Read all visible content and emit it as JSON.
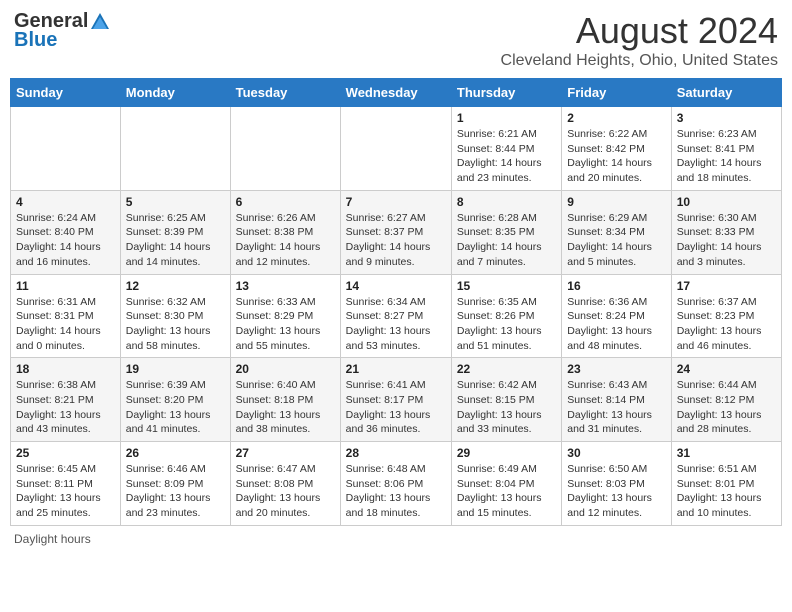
{
  "header": {
    "logo_general": "General",
    "logo_blue": "Blue",
    "month_title": "August 2024",
    "location": "Cleveland Heights, Ohio, United States"
  },
  "days_of_week": [
    "Sunday",
    "Monday",
    "Tuesday",
    "Wednesday",
    "Thursday",
    "Friday",
    "Saturday"
  ],
  "footer": {
    "daylight_hours": "Daylight hours"
  },
  "weeks": [
    {
      "days": [
        {
          "number": "",
          "info": ""
        },
        {
          "number": "",
          "info": ""
        },
        {
          "number": "",
          "info": ""
        },
        {
          "number": "",
          "info": ""
        },
        {
          "number": "1",
          "info": "Sunrise: 6:21 AM\nSunset: 8:44 PM\nDaylight: 14 hours and 23 minutes."
        },
        {
          "number": "2",
          "info": "Sunrise: 6:22 AM\nSunset: 8:42 PM\nDaylight: 14 hours and 20 minutes."
        },
        {
          "number": "3",
          "info": "Sunrise: 6:23 AM\nSunset: 8:41 PM\nDaylight: 14 hours and 18 minutes."
        }
      ]
    },
    {
      "days": [
        {
          "number": "4",
          "info": "Sunrise: 6:24 AM\nSunset: 8:40 PM\nDaylight: 14 hours and 16 minutes."
        },
        {
          "number": "5",
          "info": "Sunrise: 6:25 AM\nSunset: 8:39 PM\nDaylight: 14 hours and 14 minutes."
        },
        {
          "number": "6",
          "info": "Sunrise: 6:26 AM\nSunset: 8:38 PM\nDaylight: 14 hours and 12 minutes."
        },
        {
          "number": "7",
          "info": "Sunrise: 6:27 AM\nSunset: 8:37 PM\nDaylight: 14 hours and 9 minutes."
        },
        {
          "number": "8",
          "info": "Sunrise: 6:28 AM\nSunset: 8:35 PM\nDaylight: 14 hours and 7 minutes."
        },
        {
          "number": "9",
          "info": "Sunrise: 6:29 AM\nSunset: 8:34 PM\nDaylight: 14 hours and 5 minutes."
        },
        {
          "number": "10",
          "info": "Sunrise: 6:30 AM\nSunset: 8:33 PM\nDaylight: 14 hours and 3 minutes."
        }
      ]
    },
    {
      "days": [
        {
          "number": "11",
          "info": "Sunrise: 6:31 AM\nSunset: 8:31 PM\nDaylight: 14 hours and 0 minutes."
        },
        {
          "number": "12",
          "info": "Sunrise: 6:32 AM\nSunset: 8:30 PM\nDaylight: 13 hours and 58 minutes."
        },
        {
          "number": "13",
          "info": "Sunrise: 6:33 AM\nSunset: 8:29 PM\nDaylight: 13 hours and 55 minutes."
        },
        {
          "number": "14",
          "info": "Sunrise: 6:34 AM\nSunset: 8:27 PM\nDaylight: 13 hours and 53 minutes."
        },
        {
          "number": "15",
          "info": "Sunrise: 6:35 AM\nSunset: 8:26 PM\nDaylight: 13 hours and 51 minutes."
        },
        {
          "number": "16",
          "info": "Sunrise: 6:36 AM\nSunset: 8:24 PM\nDaylight: 13 hours and 48 minutes."
        },
        {
          "number": "17",
          "info": "Sunrise: 6:37 AM\nSunset: 8:23 PM\nDaylight: 13 hours and 46 minutes."
        }
      ]
    },
    {
      "days": [
        {
          "number": "18",
          "info": "Sunrise: 6:38 AM\nSunset: 8:21 PM\nDaylight: 13 hours and 43 minutes."
        },
        {
          "number": "19",
          "info": "Sunrise: 6:39 AM\nSunset: 8:20 PM\nDaylight: 13 hours and 41 minutes."
        },
        {
          "number": "20",
          "info": "Sunrise: 6:40 AM\nSunset: 8:18 PM\nDaylight: 13 hours and 38 minutes."
        },
        {
          "number": "21",
          "info": "Sunrise: 6:41 AM\nSunset: 8:17 PM\nDaylight: 13 hours and 36 minutes."
        },
        {
          "number": "22",
          "info": "Sunrise: 6:42 AM\nSunset: 8:15 PM\nDaylight: 13 hours and 33 minutes."
        },
        {
          "number": "23",
          "info": "Sunrise: 6:43 AM\nSunset: 8:14 PM\nDaylight: 13 hours and 31 minutes."
        },
        {
          "number": "24",
          "info": "Sunrise: 6:44 AM\nSunset: 8:12 PM\nDaylight: 13 hours and 28 minutes."
        }
      ]
    },
    {
      "days": [
        {
          "number": "25",
          "info": "Sunrise: 6:45 AM\nSunset: 8:11 PM\nDaylight: 13 hours and 25 minutes."
        },
        {
          "number": "26",
          "info": "Sunrise: 6:46 AM\nSunset: 8:09 PM\nDaylight: 13 hours and 23 minutes."
        },
        {
          "number": "27",
          "info": "Sunrise: 6:47 AM\nSunset: 8:08 PM\nDaylight: 13 hours and 20 minutes."
        },
        {
          "number": "28",
          "info": "Sunrise: 6:48 AM\nSunset: 8:06 PM\nDaylight: 13 hours and 18 minutes."
        },
        {
          "number": "29",
          "info": "Sunrise: 6:49 AM\nSunset: 8:04 PM\nDaylight: 13 hours and 15 minutes."
        },
        {
          "number": "30",
          "info": "Sunrise: 6:50 AM\nSunset: 8:03 PM\nDaylight: 13 hours and 12 minutes."
        },
        {
          "number": "31",
          "info": "Sunrise: 6:51 AM\nSunset: 8:01 PM\nDaylight: 13 hours and 10 minutes."
        }
      ]
    }
  ]
}
